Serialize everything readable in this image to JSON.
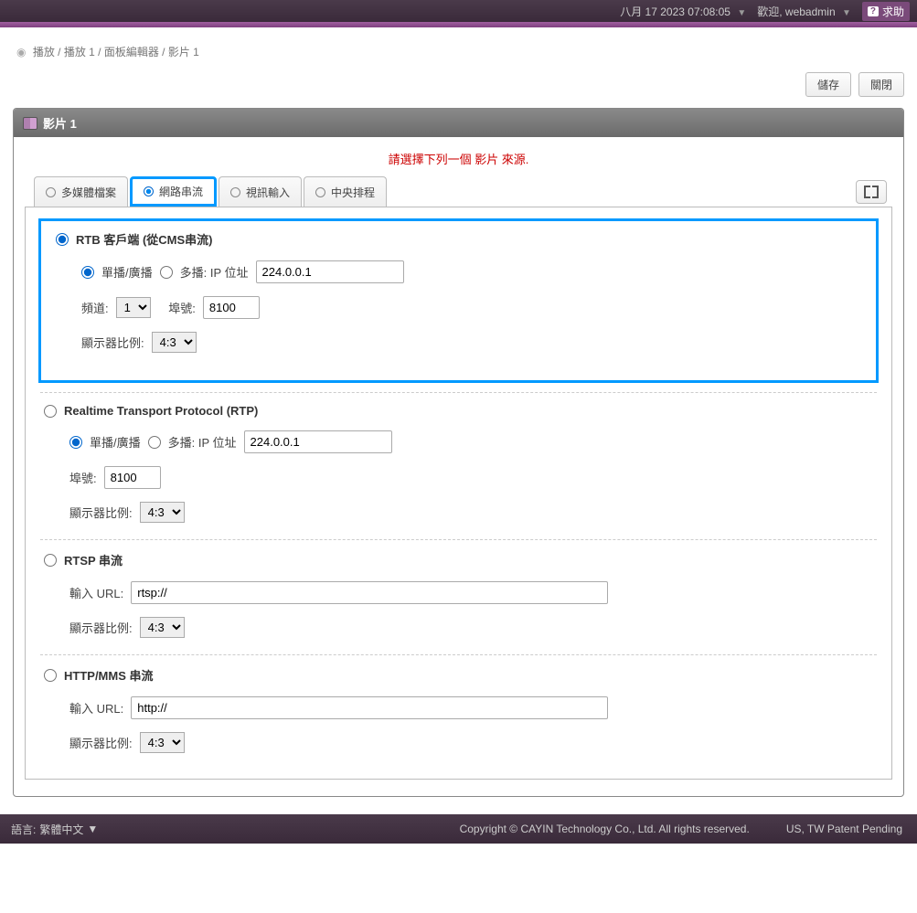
{
  "topbar": {
    "datetime": "八月 17 2023 07:08:05",
    "welcome_prefix": "歡迎,",
    "username": "webadmin",
    "help_label": "求助"
  },
  "breadcrumb": {
    "text": "播放 / 播放 1 / 面板編輯器 / 影片 1"
  },
  "actions": {
    "save": "儲存",
    "close": "關閉"
  },
  "panel": {
    "title": "影片 1",
    "hint": "請選擇下列一個 影片 來源."
  },
  "tabs": {
    "multimedia": "多媒體檔案",
    "network_stream": "網路串流",
    "video_input": "視訊輸入",
    "central_schedule": "中央排程"
  },
  "labels": {
    "unicast_broadcast": "單播/廣播",
    "multicast_ip": "多播: IP 位址",
    "channel": "頻道:",
    "port": "埠號:",
    "aspect_ratio": "顯示器比例:",
    "input_url": "輸入 URL:"
  },
  "sections": {
    "rtb": {
      "title": "RTB 客戶端 (從CMS串流)",
      "ip_value": "224.0.0.1",
      "channel_value": "1",
      "port_value": "8100",
      "ratio_value": "4:3"
    },
    "rtp": {
      "title": "Realtime Transport Protocol (RTP)",
      "ip_value": "224.0.0.1",
      "port_value": "8100",
      "ratio_value": "4:3"
    },
    "rtsp": {
      "title": "RTSP 串流",
      "url_value": "rtsp://",
      "ratio_value": "4:3"
    },
    "http": {
      "title": "HTTP/MMS 串流",
      "url_value": "http://",
      "ratio_value": "4:3"
    }
  },
  "footer": {
    "language_label": "語言:",
    "language_value": "繁體中文",
    "copyright": "Copyright © CAYIN Technology Co., Ltd. All rights reserved.",
    "patent": "US, TW Patent Pending"
  }
}
